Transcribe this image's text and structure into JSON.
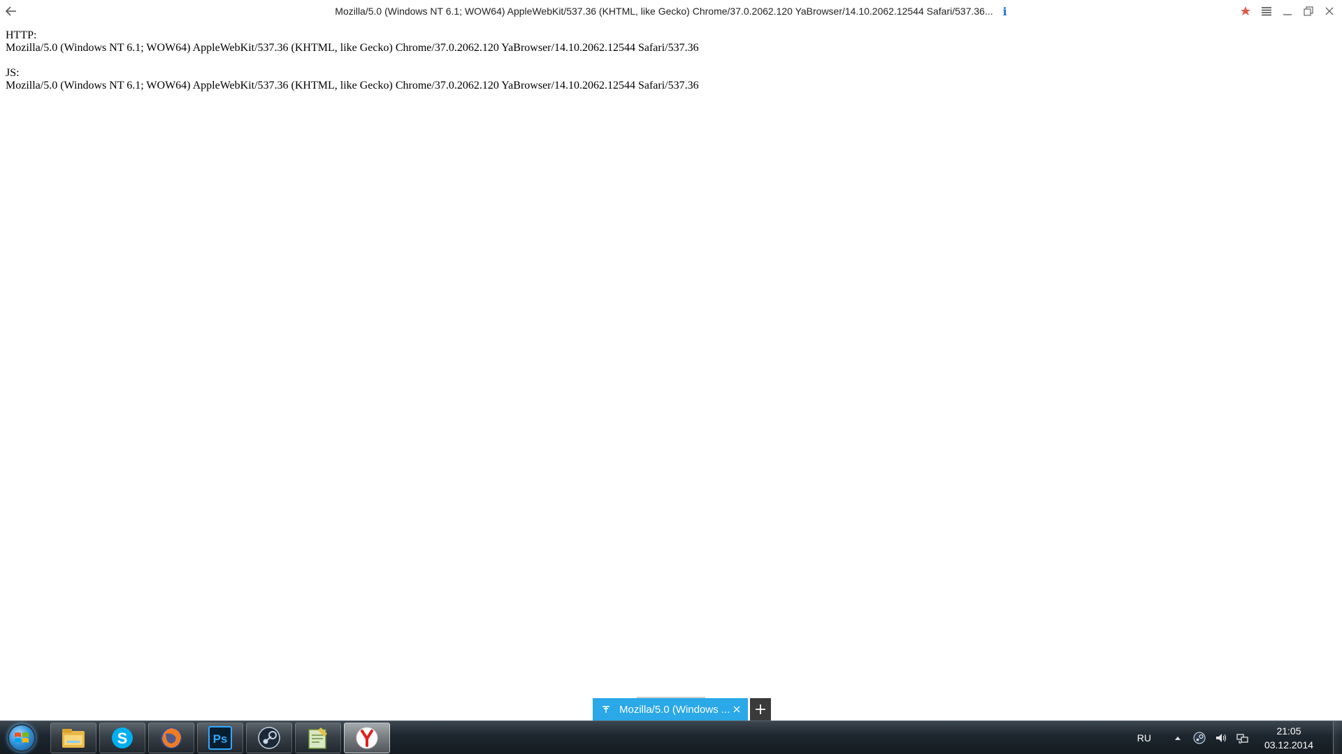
{
  "browser": {
    "title": "Mozilla/5.0 (Windows NT 6.1; WOW64) AppleWebKit/537.36 (KHTML, like Gecko) Chrome/37.0.2062.120 YaBrowser/14.10.2062.12544 Safari/537.36...",
    "accent_color": "#2aa8e8"
  },
  "page": {
    "http_label": "HTTP:",
    "http_value": "Mozilla/5.0 (Windows NT 6.1; WOW64) AppleWebKit/537.36 (KHTML, like Gecko) Chrome/37.0.2062.120 YaBrowser/14.10.2062.12544 Safari/537.36",
    "js_label": "JS:",
    "js_value": "Mozilla/5.0 (Windows NT 6.1; WOW64) AppleWebKit/537.36 (KHTML, like Gecko) Chrome/37.0.2062.120 YaBrowser/14.10.2062.12544 Safari/537.36"
  },
  "tabs": [
    {
      "label": "Mozilla/5.0 (Windows ..."
    }
  ],
  "taskbar": {
    "apps": [
      {
        "icon": "folder-icon"
      },
      {
        "icon": "skype-icon"
      },
      {
        "icon": "firefox-icon"
      },
      {
        "icon": "photoshop-icon"
      },
      {
        "icon": "steam-icon"
      },
      {
        "icon": "notepad-icon"
      },
      {
        "icon": "yandex-browser-icon"
      }
    ],
    "photoshop_label": "Ps",
    "skype_label": "S",
    "language": "RU",
    "time": "21:05",
    "date": "03.12.2014"
  }
}
